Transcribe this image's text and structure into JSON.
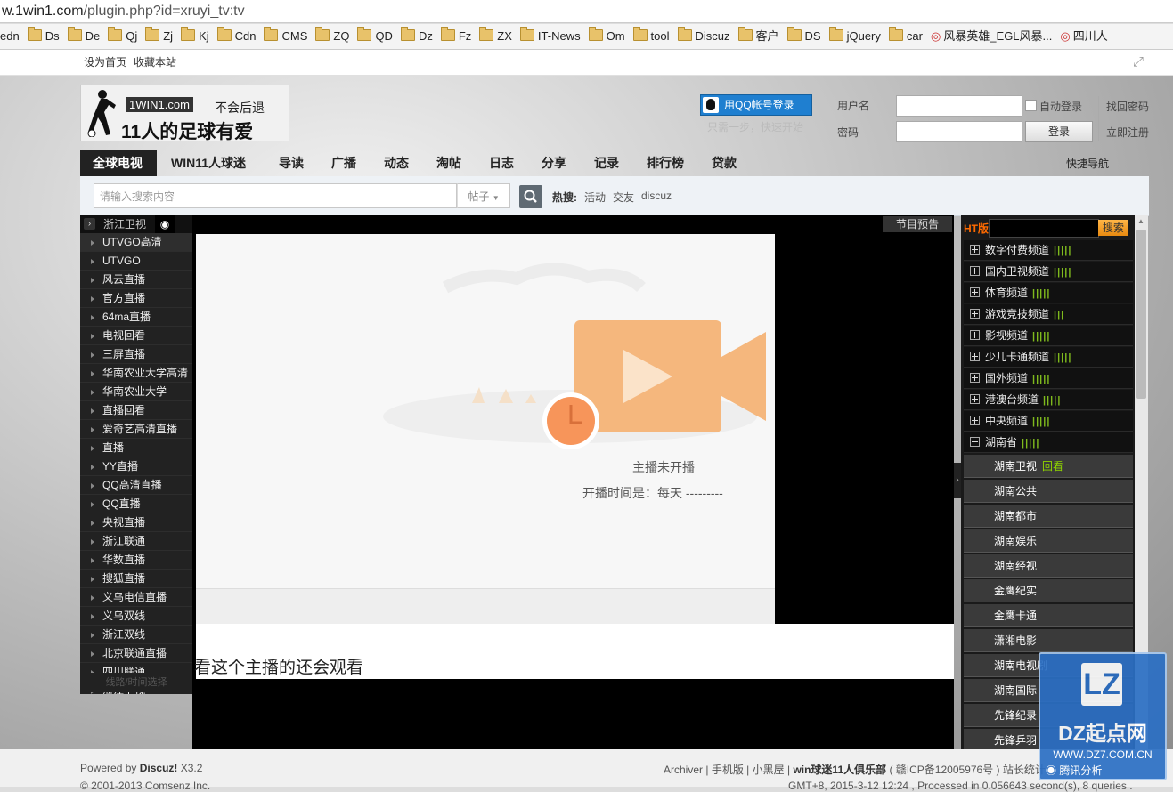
{
  "browser": {
    "url_host": "w.1win1.com",
    "url_path": "/plugin.php?id=xruyi_tv:tv",
    "bookmarks": [
      {
        "label": "edn",
        "icon": "none"
      },
      {
        "label": "Ds",
        "icon": "folder-icon"
      },
      {
        "label": "De",
        "icon": "folder-icon"
      },
      {
        "label": "Qj",
        "icon": "folder-icon"
      },
      {
        "label": "Zj",
        "icon": "folder-icon"
      },
      {
        "label": "Kj",
        "icon": "folder-icon"
      },
      {
        "label": "Cdn",
        "icon": "folder-icon"
      },
      {
        "label": "CMS",
        "icon": "folder-icon"
      },
      {
        "label": "ZQ",
        "icon": "folder-icon"
      },
      {
        "label": "QD",
        "icon": "folder-icon"
      },
      {
        "label": "Dz",
        "icon": "folder-icon"
      },
      {
        "label": "Fz",
        "icon": "folder-icon"
      },
      {
        "label": "ZX",
        "icon": "folder-icon"
      },
      {
        "label": "IT-News",
        "icon": "folder-icon"
      },
      {
        "label": "Om",
        "icon": "folder-icon"
      },
      {
        "label": "tool",
        "icon": "folder-icon"
      },
      {
        "label": "Discuz",
        "icon": "folder-icon"
      },
      {
        "label": "客户",
        "icon": "folder-icon"
      },
      {
        "label": "DS",
        "icon": "folder-icon"
      },
      {
        "label": "jQuery",
        "icon": "folder-icon"
      },
      {
        "label": "car",
        "icon": "folder-icon"
      },
      {
        "label": "风暴英雄_EGL风暴...",
        "icon": "site-icon"
      },
      {
        "label": "四川人",
        "icon": "site-icon"
      }
    ]
  },
  "topbar": {
    "set_home": "设为首页",
    "bookmark_site": "收藏本站"
  },
  "header": {
    "logo_tag": "1WIN1.com",
    "logo_slogan": "不会后退",
    "logo_title": "11人的足球有爱",
    "qq_login": "用QQ帐号登录",
    "qq_sub": "只需一步，快速开始",
    "username_label": "用户名",
    "password_label": "密码",
    "auto_login": "自动登录",
    "login_button": "登录",
    "forgot_password": "找回密码",
    "register": "立即注册"
  },
  "nav": {
    "items": [
      "全球电视",
      "WIN11人球迷",
      "导读",
      "广播",
      "动态",
      "淘帖",
      "日志",
      "分享",
      "记录",
      "排行榜",
      "贷款"
    ],
    "quick_nav": "快捷导航"
  },
  "search": {
    "placeholder": "请输入搜索内容",
    "scope": "帖子",
    "hot_label": "热搜:",
    "hot_items": [
      "活动",
      "交友",
      "discuz"
    ]
  },
  "left_panel": {
    "current_channel": "浙江卫视",
    "program_guide": "节目预告",
    "channels": [
      "UTVGO高清",
      "UTVGO",
      "风云直播",
      "官方直播",
      "64ma直播",
      "电视回看",
      "三屏直播",
      "华南农业大学高清",
      "华南农业大学",
      "直播回看",
      "爱奇艺高清直播",
      "直播",
      "YY直播",
      "QQ高清直播",
      "QQ直播",
      "央视直播",
      "浙江联通",
      "华数直播",
      "搜狐直播",
      "义乌电信直播",
      "义乌双线",
      "浙江双线",
      "北京联通直播",
      "四川联通",
      "浙江卫视"
    ],
    "footer_text": "线路/时间选择"
  },
  "player": {
    "status": "主播未开播",
    "schedule": "开播时间是：每天 ---------",
    "also_watch": "看这个主播的还会观看"
  },
  "right_panel": {
    "ht_label": "HT版",
    "search_button": "搜索",
    "groups": [
      {
        "label": "数字付费频道",
        "bars": "|||||"
      },
      {
        "label": "国内卫视频道",
        "bars": "|||||"
      },
      {
        "label": "体育频道",
        "bars": "|||||"
      },
      {
        "label": "游戏竞技频道",
        "bars": "|||"
      },
      {
        "label": "影视频道",
        "bars": "|||||"
      },
      {
        "label": "少儿卡通频道",
        "bars": "|||||"
      },
      {
        "label": "国外频道",
        "bars": "|||||"
      },
      {
        "label": "港澳台频道",
        "bars": "|||||"
      },
      {
        "label": "中央频道",
        "bars": "|||||"
      },
      {
        "label": "湖南省",
        "bars": "|||||"
      }
    ],
    "subchannels": [
      {
        "label": "湖南卫视",
        "extra": "回看"
      },
      {
        "label": "湖南公共",
        "extra": ""
      },
      {
        "label": "湖南都市",
        "extra": ""
      },
      {
        "label": "湖南娱乐",
        "extra": ""
      },
      {
        "label": "湖南经视",
        "extra": ""
      },
      {
        "label": "金鹰纪实",
        "extra": ""
      },
      {
        "label": "金鹰卡通",
        "extra": ""
      },
      {
        "label": "潇湘电影",
        "extra": ""
      },
      {
        "label": "湖南电视剧",
        "extra": ""
      },
      {
        "label": "湖南国际",
        "extra": ""
      },
      {
        "label": "先锋纪录",
        "extra": ""
      },
      {
        "label": "先锋乒羽",
        "extra": ""
      }
    ]
  },
  "footer": {
    "powered_prefix": "Powered by",
    "powered_name": "Discuz!",
    "powered_version": "X3.2",
    "copyright": "© 2001-2013 Comsenz Inc.",
    "links": [
      "Archiver",
      "手机版",
      "小黑屋"
    ],
    "site_name": "win球迷11人俱乐部",
    "icp": "( 赣ICP备12005976号 )",
    "stats": "站长统计",
    "gmt": "GMT+8, 2015-3-12 12:24 , Processed in 0.056643 second(s), 8 queries ."
  },
  "watermark": {
    "big": "DZ起点网",
    "url": "WWW.DZ7.COM.CN",
    "tencent": "腾讯分析"
  },
  "colors": {
    "accent_blue": "#1f7fd0",
    "bars_green": "#7fba1d",
    "replay_green": "#8fd400"
  }
}
